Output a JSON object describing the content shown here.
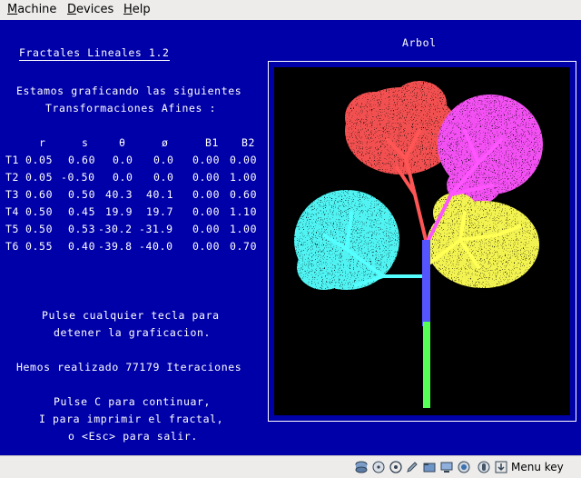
{
  "menubar": {
    "items": [
      {
        "label": "Machine",
        "accel": "M"
      },
      {
        "label": "Devices",
        "accel": "D"
      },
      {
        "label": "Help",
        "accel": "H"
      }
    ]
  },
  "screen": {
    "title": "Fractales Lineales 1.2",
    "intro_line1": "Estamos graficando las siguientes",
    "intro_line2": "Transformaciones Afines :",
    "table": {
      "headers": [
        "r",
        "s",
        "θ",
        "ø",
        "B1",
        "B2"
      ],
      "rows": [
        {
          "label": "T1",
          "values": [
            "0.05",
            "0.60",
            "0.0",
            "0.0",
            "0.00",
            "0.00"
          ]
        },
        {
          "label": "T2",
          "values": [
            "0.05",
            "-0.50",
            "0.0",
            "0.0",
            "0.00",
            "1.00"
          ]
        },
        {
          "label": "T3",
          "values": [
            "0.60",
            "0.50",
            "40.3",
            "40.1",
            "0.00",
            "0.60"
          ]
        },
        {
          "label": "T4",
          "values": [
            "0.50",
            "0.45",
            "19.9",
            "19.7",
            "0.00",
            "1.10"
          ]
        },
        {
          "label": "T5",
          "values": [
            "0.50",
            "0.53",
            "-30.2",
            "-31.9",
            "0.00",
            "1.00"
          ]
        },
        {
          "label": "T6",
          "values": [
            "0.55",
            "0.40",
            "-39.8",
            "-40.0",
            "0.00",
            "0.70"
          ]
        }
      ]
    },
    "stop_line1": "Pulse cualquier tecla para",
    "stop_line2": "detener la graficacion.",
    "iterations_text": "Hemos realizado 77179 Iteraciones",
    "continue_line1": "Pulse C para continuar,",
    "continue_line2": "I para imprimir el fractal,",
    "continue_line3": "o <Esc> para salir.",
    "plot_title": "Arbol",
    "colors": {
      "background": "#0000a8",
      "trunk_lower": "#55ff55",
      "trunk_upper": "#5555ff",
      "branch_red": "#ff5555",
      "branch_magenta": "#ff55ff",
      "branch_cyan": "#55ffff",
      "branch_yellow": "#ffff55"
    }
  },
  "statusbar": {
    "icons": [
      "hard-disk-icon",
      "optical-disc-icon",
      "usb-icon",
      "pen-icon",
      "shared-folder-icon",
      "display-icon",
      "capture-icon",
      "mouse-integration-icon"
    ],
    "host_key_label": "Menu key"
  }
}
